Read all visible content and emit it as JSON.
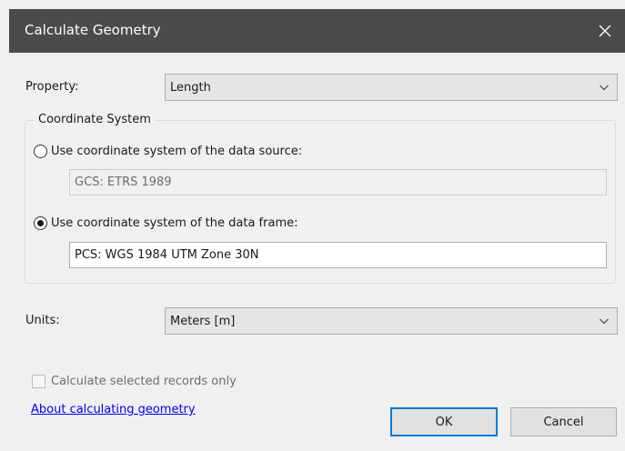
{
  "window": {
    "title": "Calculate Geometry"
  },
  "property": {
    "label": "Property:",
    "value": "Length"
  },
  "coordinate_system": {
    "legend": "Coordinate System",
    "data_source": {
      "label": "Use coordinate system of the data source:",
      "value": "GCS: ETRS 1989",
      "selected": false
    },
    "data_frame": {
      "label": "Use coordinate system of the data frame:",
      "value": "PCS: WGS 1984 UTM Zone 30N",
      "selected": true
    }
  },
  "units": {
    "label": "Units:",
    "value": "Meters [m]"
  },
  "selected_only": {
    "label": "Calculate selected records only",
    "checked": false,
    "enabled": false
  },
  "help_link": "About calculating geometry",
  "buttons": {
    "ok": "OK",
    "cancel": "Cancel"
  },
  "icons": {
    "close": "close-icon",
    "dropdown": "chevron-down-icon"
  },
  "colors": {
    "titlebar": "#4b4b4b",
    "accent": "#0078d7",
    "link": "#0000ee"
  }
}
